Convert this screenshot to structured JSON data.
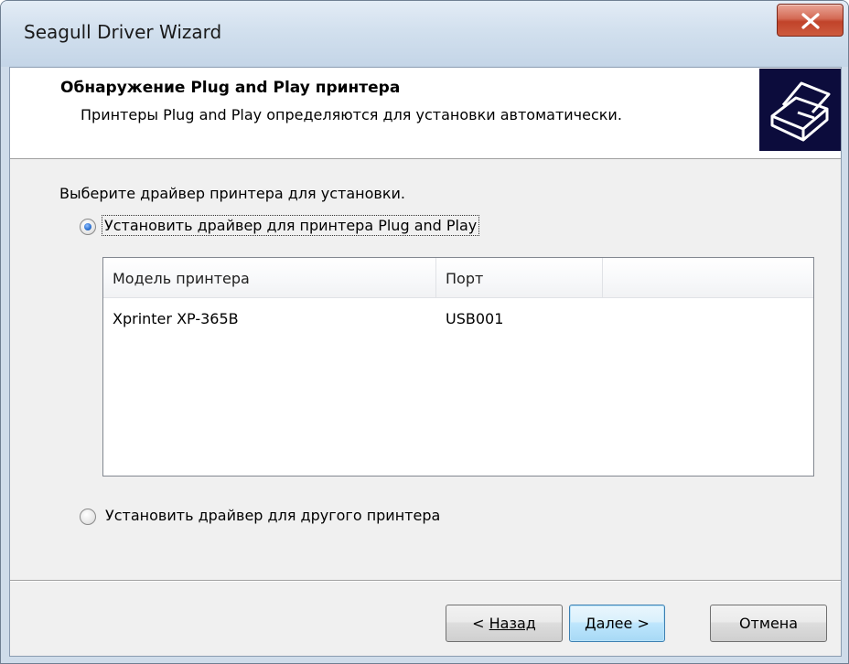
{
  "window": {
    "title": "Seagull Driver Wizard",
    "close_icon": "close-icon"
  },
  "header": {
    "title": "Обнаружение Plug and Play принтера",
    "subtitle": "Принтеры Plug and Play определяются для установки автоматически.",
    "icon": "printer-icon"
  },
  "body": {
    "prompt": "Выберите драйвер принтера для установки.",
    "options": [
      {
        "label": "Установить драйвер для принтера Plug and Play",
        "selected": true
      },
      {
        "label": "Установить драйвер для другого принтера",
        "selected": false
      }
    ],
    "printer_list": {
      "columns": [
        "Модель принтера",
        "Порт",
        ""
      ],
      "rows": [
        {
          "model": "Xprinter XP-365B",
          "port": "USB001"
        }
      ]
    }
  },
  "buttons": {
    "back_prefix": "< ",
    "back_label": "Назад",
    "next_label": "Далее >",
    "cancel_label": "Отмена"
  },
  "colors": {
    "icon_background": "#0c0c3c",
    "close_button": "#c1432a",
    "default_button_border": "#3c7fb1"
  }
}
